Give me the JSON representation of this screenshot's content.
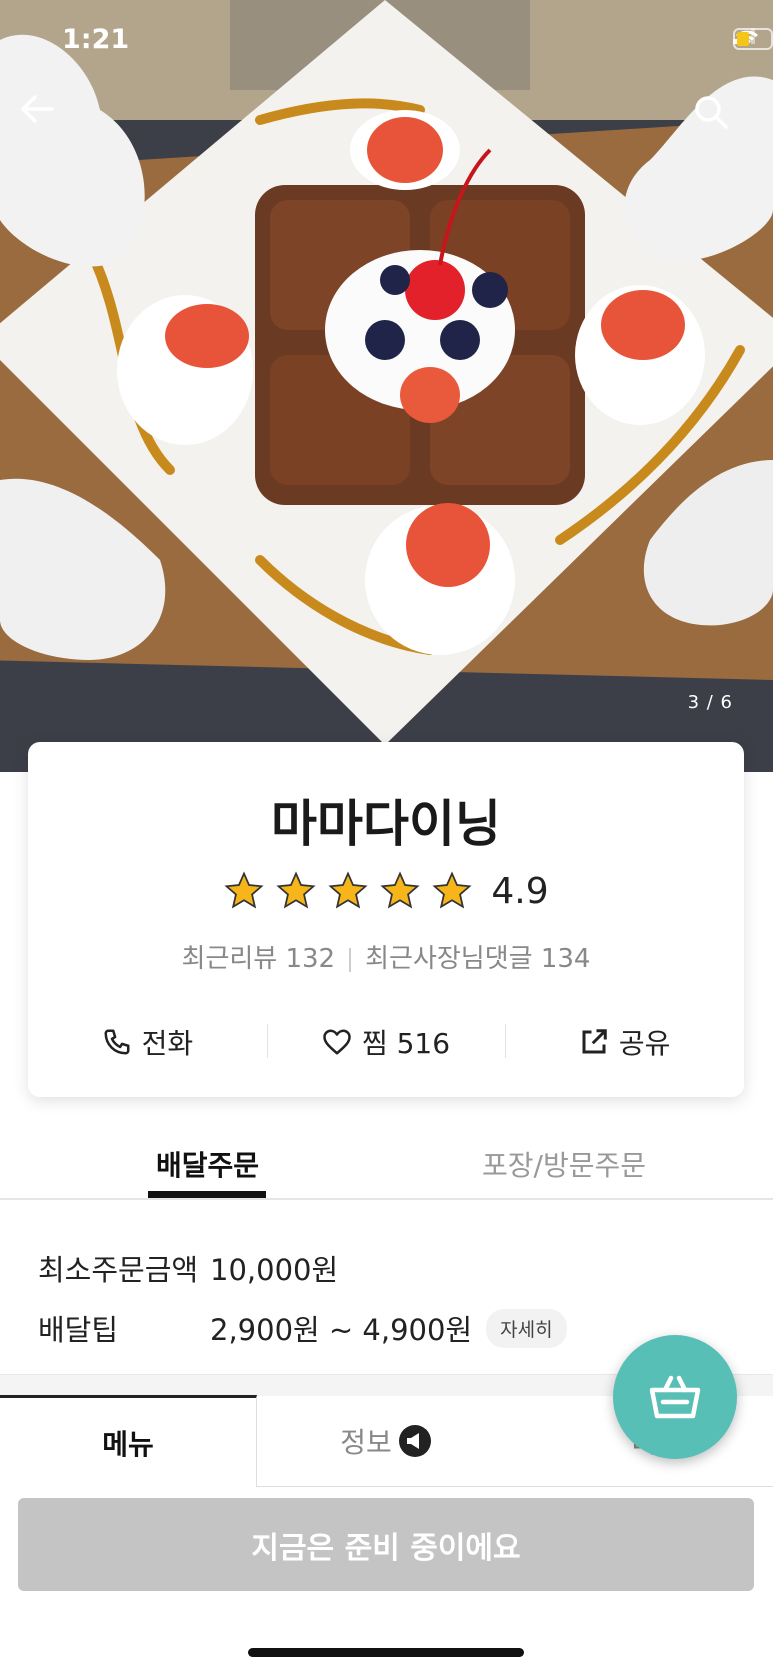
{
  "status_bar": {
    "time": "1:21"
  },
  "hero": {
    "photo_counter": "3 / 6"
  },
  "store": {
    "name": "마마다이닝",
    "rating": 4.9,
    "rating_label": "4.9",
    "recent_reviews": "최근리뷰 132",
    "owner_replies": "최근사장님댓글 134"
  },
  "actions": {
    "call": "전화",
    "like": "찜 516",
    "share": "공유"
  },
  "order_tabs": {
    "delivery": "배달주문",
    "pickup": "포장/방문주문"
  },
  "order_info": {
    "min_order_label": "최소주문금액",
    "min_order_value": "10,000원",
    "tip_label": "배달팁",
    "tip_value": "2,900원 ~ 4,900원",
    "detail": "자세히"
  },
  "menu_tabs": {
    "menu": "메뉴",
    "info": "정보",
    "review": "리"
  },
  "cta": {
    "label": "지금은 준비 중이에요"
  },
  "colors": {
    "accent": "#58bfb6",
    "cta_disabled": "#c4c4c4",
    "star": "#f5b51b"
  },
  "icons": [
    "back-arrow-icon",
    "search-icon",
    "star-icon",
    "phone-icon",
    "heart-icon",
    "share-icon",
    "megaphone-icon",
    "cart-icon"
  ]
}
